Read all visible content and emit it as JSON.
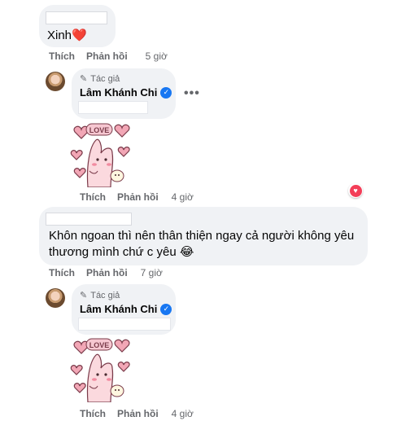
{
  "comments": [
    {
      "text": "Xinh",
      "emoji": "❤️",
      "actions": {
        "like": "Thích",
        "reply": "Phản hồi",
        "time": "5 giờ"
      }
    },
    {
      "author_badge": "Tác giả",
      "author_name": "Lâm Khánh Chi",
      "more": "•••",
      "sticker": "LOVE",
      "actions": {
        "like": "Thích",
        "reply": "Phản hồi",
        "time": "4 giờ"
      },
      "reaction": "heart"
    },
    {
      "text_line1": "Khôn ngoan thì nên thân thiện ngay cả người không yêu",
      "text_line2": "thương mình chứ c yêu",
      "emoji": "😂",
      "actions": {
        "like": "Thích",
        "reply": "Phản hồi",
        "time": "7 giờ"
      }
    },
    {
      "author_badge": "Tác giả",
      "author_name": "Lâm Khánh Chi",
      "sticker": "LOVE",
      "actions": {
        "like": "Thích",
        "reply": "Phản hồi",
        "time": "4 giờ"
      }
    }
  ],
  "colors": {
    "bubble": "#f0f2f5",
    "meta": "#65676b",
    "verified": "#1877f2",
    "heart": "#f33e58"
  }
}
